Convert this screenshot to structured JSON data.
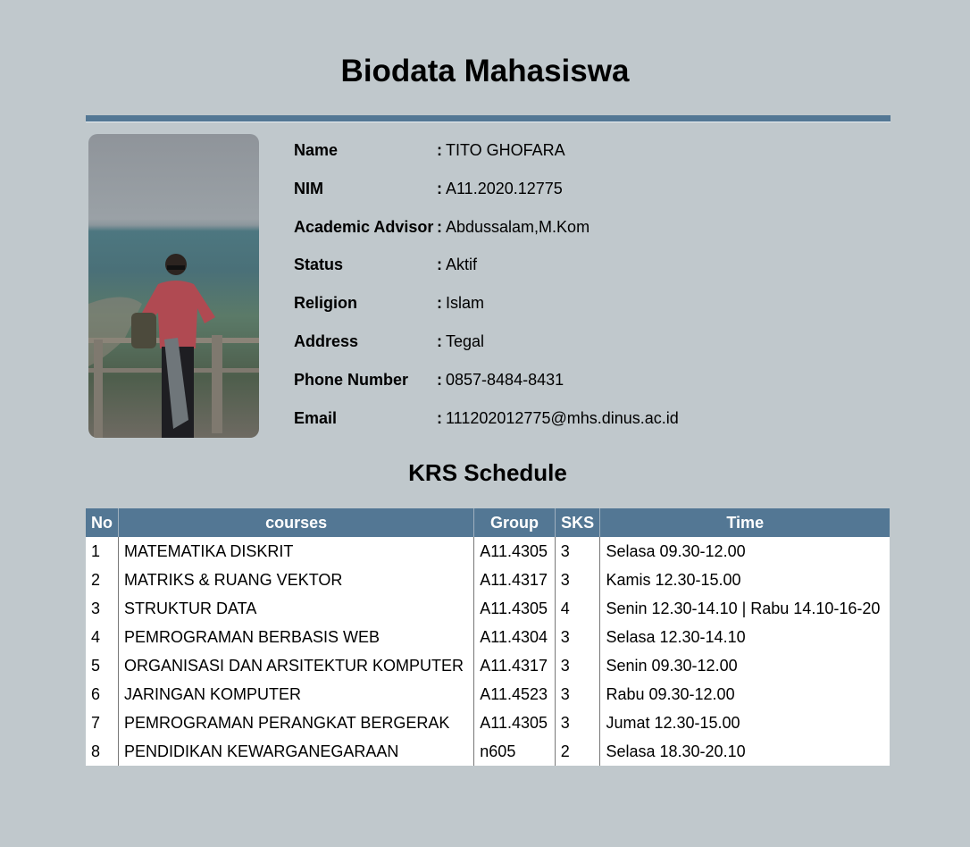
{
  "title": "Biodata Mahasiswa",
  "photo": {
    "alt": "student-photo"
  },
  "info": [
    {
      "label": "Name",
      "value": "TITO GHOFARA"
    },
    {
      "label": "NIM",
      "value": "A11.2020.12775"
    },
    {
      "label": "Academic Advisor",
      "value": "Abdussalam,M.Kom"
    },
    {
      "label": "Status",
      "value": "Aktif"
    },
    {
      "label": "Religion",
      "value": "Islam"
    },
    {
      "label": "Address",
      "value": "Tegal"
    },
    {
      "label": "Phone Number",
      "value": "0857-8484-8431"
    },
    {
      "label": "Email",
      "value": "111202012775@mhs.dinus.ac.id"
    }
  ],
  "krs": {
    "title": "KRS Schedule",
    "headers": [
      "No",
      "courses",
      "Group",
      "SKS",
      "Time"
    ],
    "rows": [
      [
        "1",
        "MATEMATIKA DISKRIT",
        "A11.4305",
        "3",
        "Selasa 09.30-12.00"
      ],
      [
        "2",
        "MATRIKS & RUANG VEKTOR",
        "A11.4317",
        "3",
        "Kamis 12.30-15.00"
      ],
      [
        "3",
        "STRUKTUR DATA",
        "A11.4305",
        "4",
        "Senin 12.30-14.10 | Rabu 14.10-16-20"
      ],
      [
        "4",
        "PEMROGRAMAN BERBASIS WEB",
        "A11.4304",
        "3",
        "Selasa 12.30-14.10"
      ],
      [
        "5",
        "ORGANISASI DAN ARSITEKTUR KOMPUTER",
        "A11.4317",
        "3",
        "Senin 09.30-12.00"
      ],
      [
        "6",
        "JARINGAN KOMPUTER",
        "A11.4523",
        "3",
        "Rabu 09.30-12.00"
      ],
      [
        "7",
        "PEMROGRAMAN PERANGKAT BERGERAK",
        "A11.4305",
        "3",
        "Jumat 12.30-15.00"
      ],
      [
        "8",
        "PENDIDIKAN KEWARGANEGARAAN",
        "n605",
        "2",
        "Selasa 18.30-20.10"
      ]
    ]
  },
  "colors": {
    "accent": "#537794",
    "background": "#c0c8cc"
  }
}
